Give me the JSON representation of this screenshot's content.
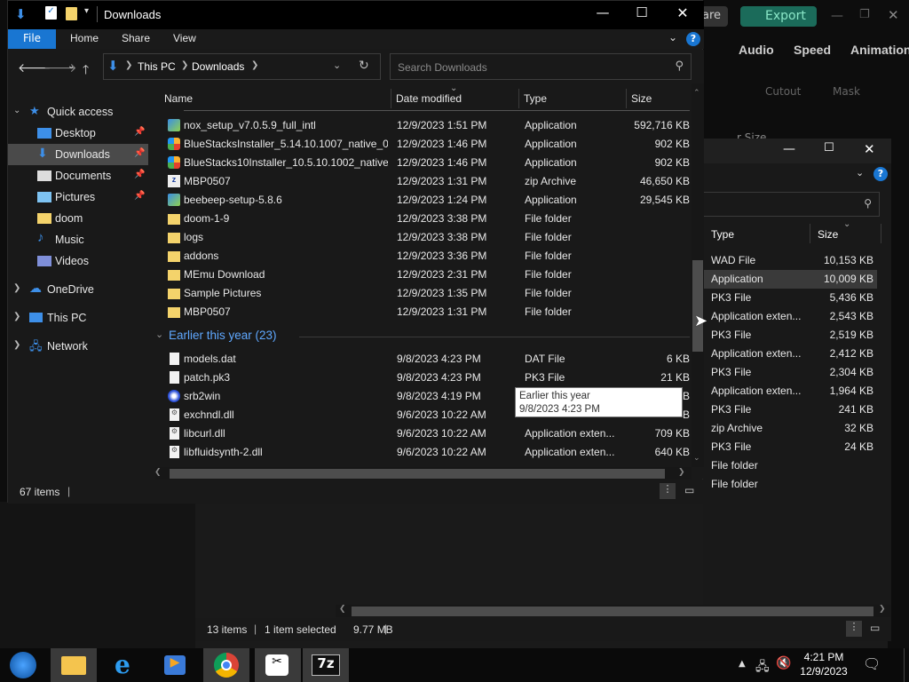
{
  "bg_app": {
    "share_label": "are",
    "export_label": "Export",
    "tabs": [
      "Audio",
      "Speed",
      "Animation"
    ],
    "subtabs": [
      "Cutout",
      "Mask"
    ],
    "size_text": "r Size"
  },
  "window": {
    "title": "Downloads"
  },
  "ribbon": {
    "tabs": [
      "File",
      "Home",
      "Share",
      "View"
    ]
  },
  "address": {
    "crumbs": [
      "This PC",
      "Downloads"
    ]
  },
  "search": {
    "placeholder": "Search Downloads"
  },
  "nav": {
    "quick_access": "Quick access",
    "items": [
      {
        "label": "Desktop",
        "pinned": true
      },
      {
        "label": "Downloads",
        "pinned": true,
        "selected": true
      },
      {
        "label": "Documents",
        "pinned": true
      },
      {
        "label": "Pictures",
        "pinned": true
      },
      {
        "label": "doom",
        "pinned": false
      },
      {
        "label": "Music",
        "pinned": false
      },
      {
        "label": "Videos",
        "pinned": false
      }
    ],
    "onedrive": "OneDrive",
    "this_pc": "This PC",
    "network": "Network"
  },
  "columns": {
    "name": "Name",
    "date": "Date modified",
    "type": "Type",
    "size": "Size"
  },
  "files": [
    {
      "name": "nox_setup_v7.0.5.9_full_intl",
      "date": "12/9/2023 1:51 PM",
      "type": "Application",
      "size": "592,716 KB",
      "icon": "app"
    },
    {
      "name": "BlueStacksInstaller_5.14.10.1007_native_0...",
      "date": "12/9/2023 1:46 PM",
      "type": "Application",
      "size": "902 KB",
      "icon": "bluestacks"
    },
    {
      "name": "BlueStacks10Installer_10.5.10.1002_native...",
      "date": "12/9/2023 1:46 PM",
      "type": "Application",
      "size": "902 KB",
      "icon": "bluestacks"
    },
    {
      "name": "MBP0507",
      "date": "12/9/2023 1:31 PM",
      "type": "zip Archive",
      "size": "46,650 KB",
      "icon": "zip"
    },
    {
      "name": "beebeep-setup-5.8.6",
      "date": "12/9/2023 1:24 PM",
      "type": "Application",
      "size": "29,545 KB",
      "icon": "app"
    },
    {
      "name": "doom-1-9",
      "date": "12/9/2023 3:38 PM",
      "type": "File folder",
      "size": "",
      "icon": "folder"
    },
    {
      "name": "logs",
      "date": "12/9/2023 3:38 PM",
      "type": "File folder",
      "size": "",
      "icon": "folder"
    },
    {
      "name": "addons",
      "date": "12/9/2023 3:36 PM",
      "type": "File folder",
      "size": "",
      "icon": "folder"
    },
    {
      "name": "MEmu Download",
      "date": "12/9/2023 2:31 PM",
      "type": "File folder",
      "size": "",
      "icon": "folder"
    },
    {
      "name": "Sample Pictures",
      "date": "12/9/2023 1:35 PM",
      "type": "File folder",
      "size": "",
      "icon": "folder"
    },
    {
      "name": "MBP0507",
      "date": "12/9/2023 1:31 PM",
      "type": "File folder",
      "size": "",
      "icon": "folder"
    }
  ],
  "group2": {
    "label": "Earlier this year (23)"
  },
  "files2": [
    {
      "name": "models.dat",
      "date": "9/8/2023 4:23 PM",
      "type": "DAT File",
      "size": "6 KB",
      "icon": "file"
    },
    {
      "name": "patch.pk3",
      "date": "9/8/2023 4:23 PM",
      "type": "PK3 File",
      "size": "21 KB",
      "icon": "file"
    },
    {
      "name": "srb2win",
      "date": "9/8/2023 4:19 PM",
      "type": "",
      "size": "B",
      "icon": "srb2"
    },
    {
      "name": "exchndl.dll",
      "date": "9/6/2023 10:22 AM",
      "type": "",
      "size": "B",
      "icon": "dll"
    },
    {
      "name": "libcurl.dll",
      "date": "9/6/2023 10:22 AM",
      "type": "Application exten...",
      "size": "709 KB",
      "icon": "dll"
    },
    {
      "name": "libfluidsynth-2.dll",
      "date": "9/6/2023 10:22 AM",
      "type": "Application exten...",
      "size": "640 KB",
      "icon": "dll"
    }
  ],
  "tooltip": {
    "line1": "Earlier this year",
    "line2": "9/8/2023 4:23 PM"
  },
  "status": {
    "items": "67 items"
  },
  "win2": {
    "col_type": "Type",
    "col_size": "Size",
    "rows": [
      {
        "type": "WAD File",
        "size": "10,153 KB"
      },
      {
        "type": "Application",
        "size": "10,009 KB",
        "selected": true
      },
      {
        "type": "PK3 File",
        "size": "5,436 KB"
      },
      {
        "type": "Application exten...",
        "size": "2,543 KB"
      },
      {
        "type": "PK3 File",
        "size": "2,519 KB"
      },
      {
        "type": "Application exten...",
        "size": "2,412 KB"
      },
      {
        "type": "PK3 File",
        "size": "2,304 KB"
      },
      {
        "type": "Application exten...",
        "size": "1,964 KB"
      },
      {
        "type": "PK3 File",
        "size": "241 KB"
      },
      {
        "type": "zip Archive",
        "size": "32 KB"
      },
      {
        "type": "PK3 File",
        "size": "24 KB"
      },
      {
        "type": "File folder",
        "size": ""
      },
      {
        "type": "File folder",
        "size": ""
      }
    ],
    "status_items": "13 items",
    "status_selected": "1 item selected",
    "status_size": "9.77 MB"
  },
  "taskbar": {
    "time": "4:21 PM",
    "date": "12/9/2023"
  }
}
